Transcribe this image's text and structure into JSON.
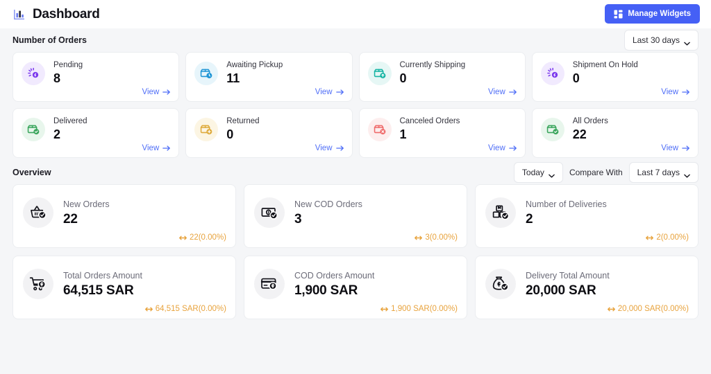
{
  "header": {
    "title": "Dashboard",
    "brand_icon": "bar-chart-icon",
    "manage_widgets_label": "Manage Widgets",
    "manage_widgets_icon": "widgets-grid-icon",
    "accent_color": "#4560f5"
  },
  "orders_section": {
    "title": "Number of Orders",
    "range_dropdown": "Last 30 days",
    "view_label": "View",
    "cards": [
      {
        "label": "Pending",
        "value": "8",
        "icon": "spinner-status-icon",
        "icon_color": "#7c3aed",
        "icon_bg": "#f1eafe"
      },
      {
        "label": "Awaiting Pickup",
        "value": "11",
        "icon": "box-clock-icon",
        "icon_color": "#2196d6",
        "icon_bg": "#e7f5fb"
      },
      {
        "label": "Currently Shipping",
        "value": "0",
        "icon": "box-arrow-up-icon",
        "icon_color": "#17b5a4",
        "icon_bg": "#e6f7f5"
      },
      {
        "label": "Shipment On Hold",
        "value": "0",
        "icon": "spinner-status-icon",
        "icon_color": "#7c3aed",
        "icon_bg": "#f1eafe"
      },
      {
        "label": "Delivered",
        "value": "2",
        "icon": "box-check-icon",
        "icon_color": "#3aa55c",
        "icon_bg": "#e8f6ec"
      },
      {
        "label": "Returned",
        "value": "0",
        "icon": "box-plus-icon",
        "icon_color": "#deaa3b",
        "icon_bg": "#fcf5e3"
      },
      {
        "label": "Canceled Orders",
        "value": "1",
        "icon": "box-cross-icon",
        "icon_color": "#ef6b6b",
        "icon_bg": "#fdeeee"
      },
      {
        "label": "All Orders",
        "value": "22",
        "icon": "box-check-icon",
        "icon_color": "#3aa55c",
        "icon_bg": "#e8f6ec"
      }
    ]
  },
  "overview_section": {
    "title": "Overview",
    "period_dropdown": "Today",
    "compare_label": "Compare With",
    "compare_dropdown": "Last 7 days",
    "delta_color": "#e8a33d",
    "cards": [
      {
        "label": "New Orders",
        "value": "22",
        "delta": "22(0.00%)",
        "icon": "basket-check-icon"
      },
      {
        "label": "New COD Orders",
        "value": "3",
        "delta": "3(0.00%)",
        "icon": "banknote-check-icon"
      },
      {
        "label": "Number of Deliveries",
        "value": "2",
        "delta": "2(0.00%)",
        "icon": "boxes-check-icon"
      },
      {
        "label": "Total Orders Amount",
        "value": "64,515 SAR",
        "delta": "64,515 SAR(0.00%)",
        "icon": "cart-dollar-icon"
      },
      {
        "label": "COD Orders Amount",
        "value": "1,900 SAR",
        "delta": "1,900 SAR(0.00%)",
        "icon": "credit-card-dollar-icon"
      },
      {
        "label": "Delivery Total Amount",
        "value": "20,000 SAR",
        "delta": "20,000 SAR(0.00%)",
        "icon": "money-bag-check-icon"
      }
    ]
  }
}
